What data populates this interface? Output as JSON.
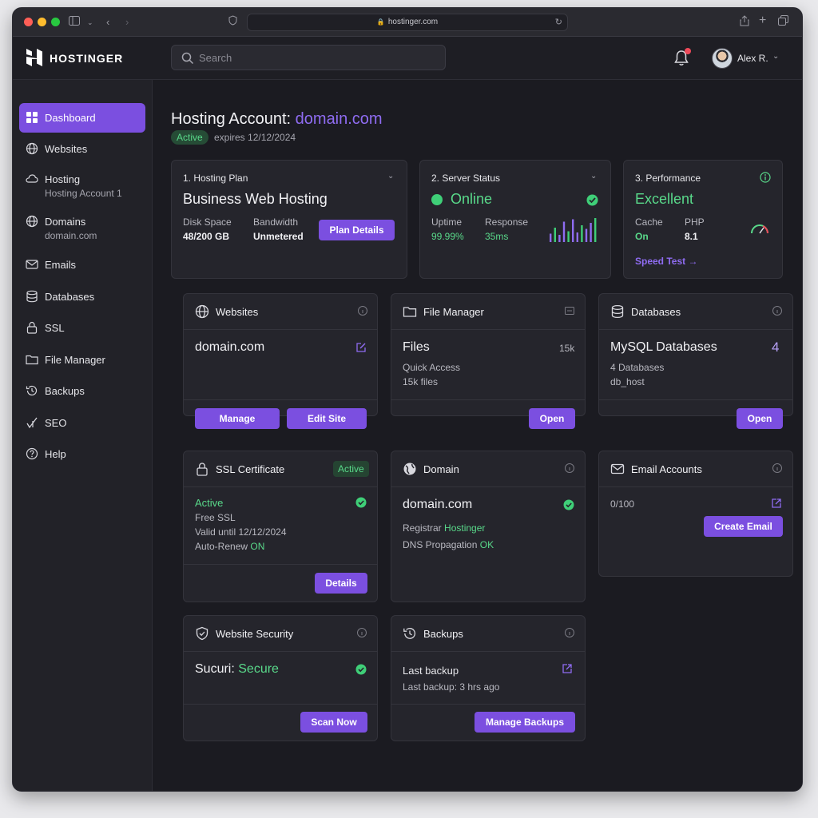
{
  "browser": {
    "url": "hostinger.com"
  },
  "app": {
    "logo_text": "HOSTINGER",
    "search_placeholder": "Search",
    "user_name": "Alex R."
  },
  "sidebar": {
    "items": [
      {
        "label": "Dashboard",
        "sub": "",
        "icon": "dashboard-icon",
        "active": true
      },
      {
        "label": "Websites",
        "sub": "",
        "icon": "globe-icon"
      },
      {
        "label": "Hosting",
        "sub": "Hosting Account 1",
        "icon": "cloud-icon"
      },
      {
        "label": "Domains",
        "sub": "domain.com",
        "icon": "globe-icon"
      },
      {
        "label": "Emails",
        "sub": "",
        "icon": "mail-icon"
      },
      {
        "label": "Databases",
        "sub": "",
        "icon": "database-icon"
      },
      {
        "label": "SSL",
        "sub": "",
        "icon": "lock-icon"
      },
      {
        "label": "File Manager",
        "sub": "",
        "icon": "folder-icon"
      },
      {
        "label": "Backups",
        "sub": "",
        "icon": "history-icon"
      },
      {
        "label": "SEO",
        "sub": "",
        "icon": "seo-icon"
      },
      {
        "label": "Help",
        "sub": "",
        "icon": "help-icon"
      }
    ]
  },
  "header": {
    "title_prefix": "Hosting Account:",
    "title_domain": "domain.com",
    "status": "Active",
    "expires": "expires 12/12/2024"
  },
  "plan_card": {
    "title": "1. Hosting Plan",
    "name": "Business Web Hosting",
    "disk_label": "Disk Space",
    "disk_value": "48/200 GB",
    "bandwidth_label": "Bandwidth",
    "bandwidth_value": "Unmetered",
    "button": "Plan Details"
  },
  "server_card": {
    "title": "2. Server Status",
    "status": "Online",
    "uptime_label": "Uptime",
    "uptime_value": "99.99%",
    "response_label": "Response",
    "response_value": "35ms",
    "bars": [
      0.35,
      0.6,
      0.3,
      0.85,
      0.45,
      0.95,
      0.4,
      0.7,
      0.55,
      0.8,
      1.0
    ]
  },
  "perf_card": {
    "title": "3. Performance",
    "rating": "Excellent",
    "cache_label": "Cache",
    "cache_value": "On",
    "php_label": "PHP",
    "php_value": "8.1",
    "link": "Speed Test"
  },
  "websites_card": {
    "title": "Websites",
    "domain": "domain.com",
    "btn_manage": "Manage",
    "btn_edit": "Edit Site"
  },
  "files_card": {
    "title": "File Manager",
    "heading": "Files",
    "count": "15k",
    "quick": "Quick Access",
    "files": "15k files",
    "button": "Open"
  },
  "db_card": {
    "title": "Databases",
    "heading": "MySQL Databases",
    "count": "4",
    "line1": "4 Databases",
    "line2": "db_host",
    "button": "Open"
  },
  "ssl_card": {
    "title": "SSL Certificate",
    "badge": "Active",
    "status": "Active",
    "type": "Free SSL",
    "valid": "Valid until 12/12/2024",
    "renew_label": "Auto-Renew",
    "renew_value": "ON",
    "button": "Details"
  },
  "domain_card": {
    "title": "Domain",
    "domain": "domain.com",
    "registrar_label": "Registrar",
    "registrar_value": "Hostinger",
    "dns_label": "DNS Propagation",
    "dns_value": "OK"
  },
  "email_card": {
    "title": "Email Accounts",
    "count": "0/100",
    "button": "Create Email"
  },
  "security_card": {
    "title": "Website Security",
    "label": "Sucuri:",
    "value": "Secure",
    "button": "Scan Now"
  },
  "backups_card": {
    "title": "Backups",
    "line1": "Last backup",
    "line2": "Last backup: 3 hrs ago",
    "button": "Manage Backups"
  },
  "colors": {
    "accent": "#7b4fe0",
    "accent_text": "#8f6cf2",
    "success": "#59d98a",
    "background": "#1b1b21",
    "card": "#25252c"
  }
}
